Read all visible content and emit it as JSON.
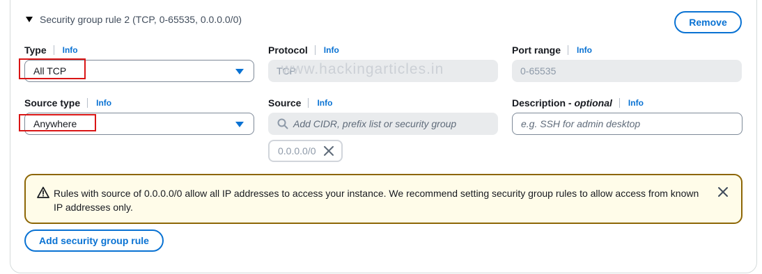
{
  "rule": {
    "title": "Security group rule 2 (TCP, 0-65535, 0.0.0.0/0)",
    "remove_label": "Remove"
  },
  "fields": {
    "type": {
      "label": "Type",
      "info": "Info",
      "value": "All TCP"
    },
    "protocol": {
      "label": "Protocol",
      "info": "Info",
      "value": "TCP"
    },
    "port_range": {
      "label": "Port range",
      "info": "Info",
      "value": "0-65535"
    },
    "source_type": {
      "label": "Source type",
      "info": "Info",
      "value": "Anywhere"
    },
    "source": {
      "label": "Source",
      "info": "Info",
      "placeholder": "Add CIDR, prefix list or security group",
      "token": "0.0.0.0/0"
    },
    "description": {
      "label": "Description",
      "label_optional": "optional",
      "label_dash": " - ",
      "info": "Info",
      "placeholder": "e.g. SSH for admin desktop"
    }
  },
  "watermark": "www.hackingarticles.in",
  "alert": {
    "message": "Rules with source of 0.0.0.0/0 allow all IP addresses to access your instance. We recommend setting security group rules to allow access from known IP addresses only."
  },
  "add_rule_label": "Add security group rule",
  "icons": {
    "caret": "caret-down-icon",
    "dropdown": "dropdown-arrow-icon",
    "search": "search-icon",
    "remove_token": "close-icon",
    "warning": "warning-icon",
    "dismiss": "close-icon"
  },
  "colors": {
    "accent": "#0972d3",
    "warning_border": "#8d6605",
    "warning_bg": "#fffce9",
    "highlight": "#d91515"
  }
}
